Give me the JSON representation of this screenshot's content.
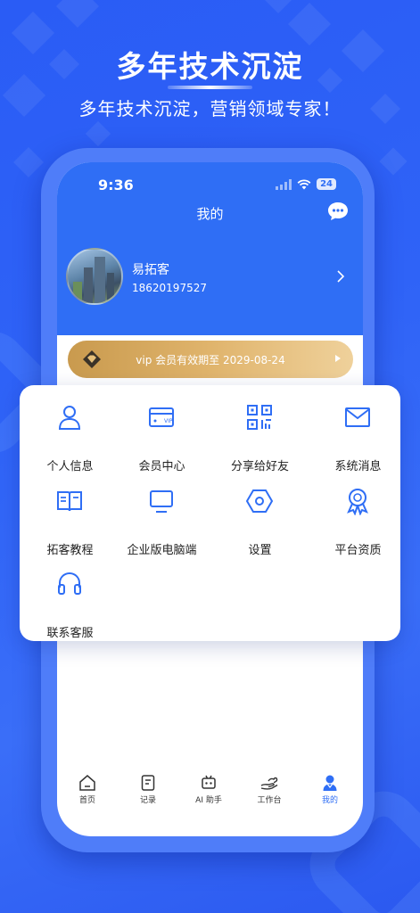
{
  "hero": {
    "title": "多年技术沉淀",
    "subtitle": "多年技术沉淀，营销领域专家！"
  },
  "status_bar": {
    "time": "9:36",
    "battery": "24"
  },
  "nav": {
    "title": "我的",
    "chat_icon": "chat-bubble-icon"
  },
  "profile": {
    "name": "易拓客",
    "phone": "18620197527"
  },
  "vip": {
    "text": "vip 会员有效期至 2029-08-24"
  },
  "menu": {
    "items": [
      {
        "label": "个人信息",
        "icon": "user-icon"
      },
      {
        "label": "会员中心",
        "icon": "card-icon"
      },
      {
        "label": "分享给好友",
        "icon": "qrcode-icon"
      },
      {
        "label": "系统消息",
        "icon": "mail-icon"
      },
      {
        "label": "拓客教程",
        "icon": "book-icon"
      },
      {
        "label": "企业版电脑端",
        "icon": "monitor-icon"
      },
      {
        "label": "设置",
        "icon": "hexagon-settings-icon"
      },
      {
        "label": "平台资质",
        "icon": "award-icon"
      },
      {
        "label": "联系客服",
        "icon": "headset-icon"
      }
    ]
  },
  "tabs": [
    {
      "label": "首页",
      "icon": "home-icon"
    },
    {
      "label": "记录",
      "icon": "document-icon"
    },
    {
      "label": "AI 助手",
      "icon": "robot-icon"
    },
    {
      "label": "工作台",
      "icon": "hand-icon"
    },
    {
      "label": "我的",
      "icon": "person-icon",
      "active": true
    }
  ],
  "colors": {
    "primary": "#2f6ef5",
    "background": "#2f63f7",
    "vip_gold": "#e0b46c"
  }
}
